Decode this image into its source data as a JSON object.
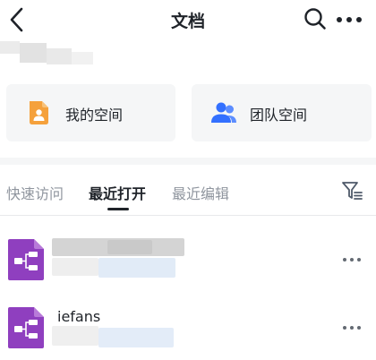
{
  "header": {
    "title": "文档",
    "back_icon": "chevron-left-icon",
    "search_icon": "search-icon",
    "more_icon": "more-horizontal-icon"
  },
  "spaces": [
    {
      "label": "我的空间",
      "icon": "my-space-icon",
      "color": "#f5a13c"
    },
    {
      "label": "团队空间",
      "icon": "team-icon",
      "color": "#3370ff"
    }
  ],
  "tabs": [
    {
      "label": "快速访问",
      "active": false
    },
    {
      "label": "最近打开",
      "active": true
    },
    {
      "label": "最近编辑",
      "active": false
    }
  ],
  "filter_icon": "filter-icon",
  "files": [
    {
      "name": "",
      "icon": "mindmap-file-icon"
    },
    {
      "name": "iefans",
      "icon": "mindmap-file-icon"
    }
  ],
  "colors": {
    "card_bg": "#f5f6f7",
    "text_primary": "#1f2329",
    "text_secondary": "#8f959e",
    "mindmap_purple": "#8f3fbf"
  }
}
